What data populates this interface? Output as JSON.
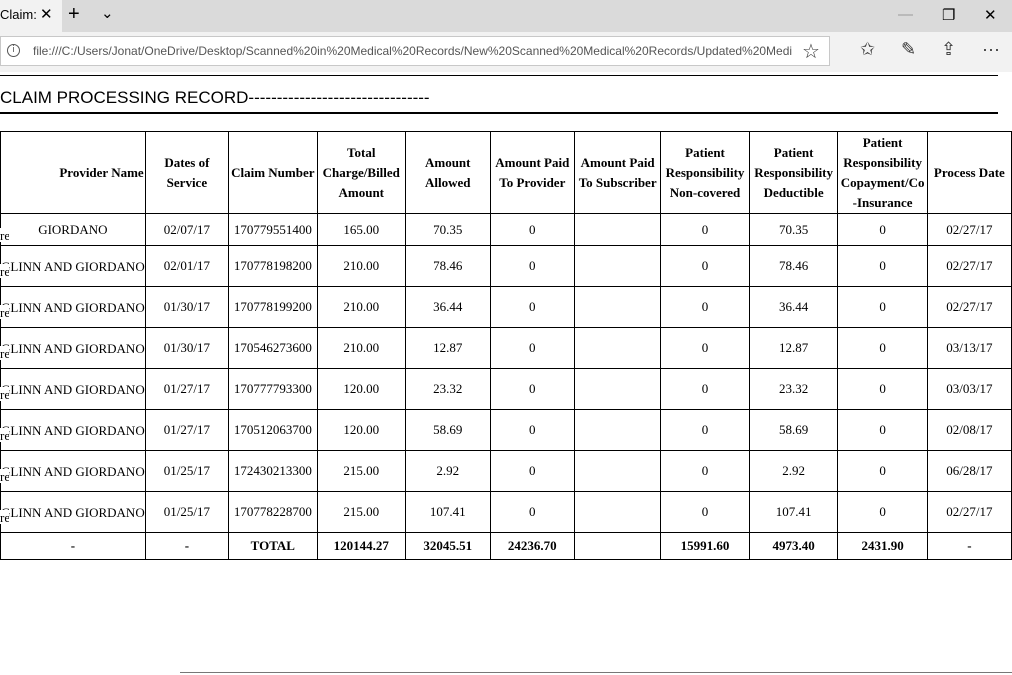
{
  "browser": {
    "tab_title": "Claim:",
    "tab_close_glyph": "✕",
    "new_tab_glyph": "+",
    "tab_list_glyph": "⌄",
    "minimize_glyph": "—",
    "restore_glyph": "❐",
    "close_glyph": "✕",
    "url": "file:///C:/Users/Jonat/OneDrive/Desktop/Scanned%20in%20Medical%20Records/New%20Scanned%20Medical%20Records/Updated%20Medi",
    "favorite_glyph": "☆",
    "favorites_glyph": "✩",
    "notes_glyph": "✎",
    "share_glyph": "⇪",
    "more_glyph": "···"
  },
  "page": {
    "title": "CLAIM PROCESSING RECORD--------------------------------"
  },
  "table": {
    "columns": [
      "Provider Name",
      "Dates of Service",
      "Claim Number",
      "Total Charge/Billed Amount",
      "Amount Allowed",
      "Amount Paid To Provider",
      "Amount Paid To Subscriber",
      "Patient Responsibility Non-covered",
      "Patient Responsibility Deductible",
      "Patient Responsibility Copayment/Co -Insurance",
      "Process Date"
    ],
    "row_stub": "re",
    "rows": [
      {
        "provider": "GIORDANO",
        "date": "02/07/17",
        "claim": "170779551400",
        "charge": "165.00",
        "allowed": "70.35",
        "paid_provider": "0",
        "paid_subscriber": "",
        "non_covered": "0",
        "deductible": "70.35",
        "copay": "0",
        "process_date": "02/27/17"
      },
      {
        "provider": "GLINN AND GIORDANO",
        "date": "02/01/17",
        "claim": "170778198200",
        "charge": "210.00",
        "allowed": "78.46",
        "paid_provider": "0",
        "paid_subscriber": "",
        "non_covered": "0",
        "deductible": "78.46",
        "copay": "0",
        "process_date": "02/27/17"
      },
      {
        "provider": "GLINN AND GIORDANO",
        "date": "01/30/17",
        "claim": "170778199200",
        "charge": "210.00",
        "allowed": "36.44",
        "paid_provider": "0",
        "paid_subscriber": "",
        "non_covered": "0",
        "deductible": "36.44",
        "copay": "0",
        "process_date": "02/27/17"
      },
      {
        "provider": "GLINN AND GIORDANO",
        "date": "01/30/17",
        "claim": "170546273600",
        "charge": "210.00",
        "allowed": "12.87",
        "paid_provider": "0",
        "paid_subscriber": "",
        "non_covered": "0",
        "deductible": "12.87",
        "copay": "0",
        "process_date": "03/13/17"
      },
      {
        "provider": "GLINN AND GIORDANO",
        "date": "01/27/17",
        "claim": "170777793300",
        "charge": "120.00",
        "allowed": "23.32",
        "paid_provider": "0",
        "paid_subscriber": "",
        "non_covered": "0",
        "deductible": "23.32",
        "copay": "0",
        "process_date": "03/03/17"
      },
      {
        "provider": "GLINN AND GIORDANO",
        "date": "01/27/17",
        "claim": "170512063700",
        "charge": "120.00",
        "allowed": "58.69",
        "paid_provider": "0",
        "paid_subscriber": "",
        "non_covered": "0",
        "deductible": "58.69",
        "copay": "0",
        "process_date": "02/08/17"
      },
      {
        "provider": "GLINN AND GIORDANO",
        "date": "01/25/17",
        "claim": "172430213300",
        "charge": "215.00",
        "allowed": "2.92",
        "paid_provider": "0",
        "paid_subscriber": "",
        "non_covered": "0",
        "deductible": "2.92",
        "copay": "0",
        "process_date": "06/28/17"
      },
      {
        "provider": "GLINN AND GIORDANO",
        "date": "01/25/17",
        "claim": "170778228700",
        "charge": "215.00",
        "allowed": "107.41",
        "paid_provider": "0",
        "paid_subscriber": "",
        "non_covered": "0",
        "deductible": "107.41",
        "copay": "0",
        "process_date": "02/27/17"
      }
    ],
    "totals": {
      "provider": "-",
      "date": "-",
      "claim": "TOTAL",
      "charge": "120144.27",
      "allowed": "32045.51",
      "paid_provider": "24236.70",
      "paid_subscriber": "",
      "non_covered": "15991.60",
      "deductible": "4973.40",
      "copay": "2431.90",
      "process_date": "-"
    }
  }
}
